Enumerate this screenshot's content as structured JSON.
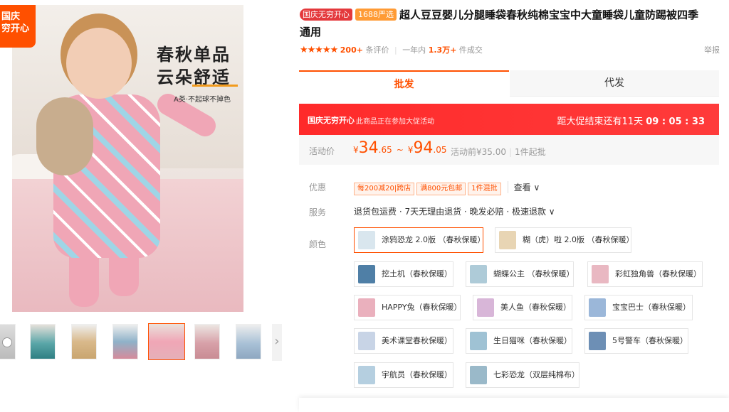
{
  "gallery": {
    "badge": [
      "国庆",
      "穷开心"
    ],
    "hero_title_line1": "春秋单品",
    "hero_title_line2": "云朵舒适",
    "hero_subtitle": "A类·不起球不掉色",
    "next_icon": "chevron-right-icon"
  },
  "product": {
    "tag1": "国庆无穷开心",
    "tag2": "1688严选",
    "title": "超人豆豆婴儿分腿睡袋春秋纯棉宝宝中大童睡袋儿童防踢被四季通用",
    "stars": "★★★★★",
    "review_count": "200+",
    "review_label": "条评价",
    "sales_label": "一年内",
    "sales_count": "1.3万+",
    "sales_unit": "件成交",
    "report": "举报"
  },
  "tabs": {
    "wholesale": "批发",
    "dropship": "代发"
  },
  "promo": {
    "label": "国庆无穷开心",
    "desc": "此商品正在参加大促活动",
    "countdown_prefix": "距大促结束还有",
    "countdown_days": "11天",
    "countdown_time": "09 : 05 : 33"
  },
  "price": {
    "label": "活动价",
    "low_int": "34",
    "low_dec": ".65",
    "high_int": "94",
    "high_dec": ".05",
    "currency": "¥",
    "dash": "~",
    "before": "活动前¥35.00",
    "moq": "1件起批"
  },
  "discount": {
    "label": "优惠",
    "coupons": [
      "每200减20|跨店",
      "满800元包邮",
      "1件混批"
    ],
    "see": "查看 ∨"
  },
  "service": {
    "label": "服务",
    "text": "退货包运费 · 7天无理由退货 · 晚发必赔 · 极速退款 ∨"
  },
  "color": {
    "label": "颜色",
    "options": [
      "涂鸦恐龙 2.0版 （春秋保暖）",
      "糊（虎）啦 2.0版 （春秋保暖）",
      "挖土机（春秋保暖）",
      "蝴蝶公主 （春秋保暖）",
      "彩虹独角兽（春秋保暖）",
      "HAPPY兔（春秋保暖）",
      "美人鱼（春秋保暖）",
      "宝宝巴士（春秋保暖）",
      "美术课堂春秋保暖）",
      "生日猫咪（春秋保暖）",
      "5号警车（春秋保暖）",
      "宇航员（春秋保暖）",
      "七彩恐龙（双层纯棉布）"
    ]
  }
}
